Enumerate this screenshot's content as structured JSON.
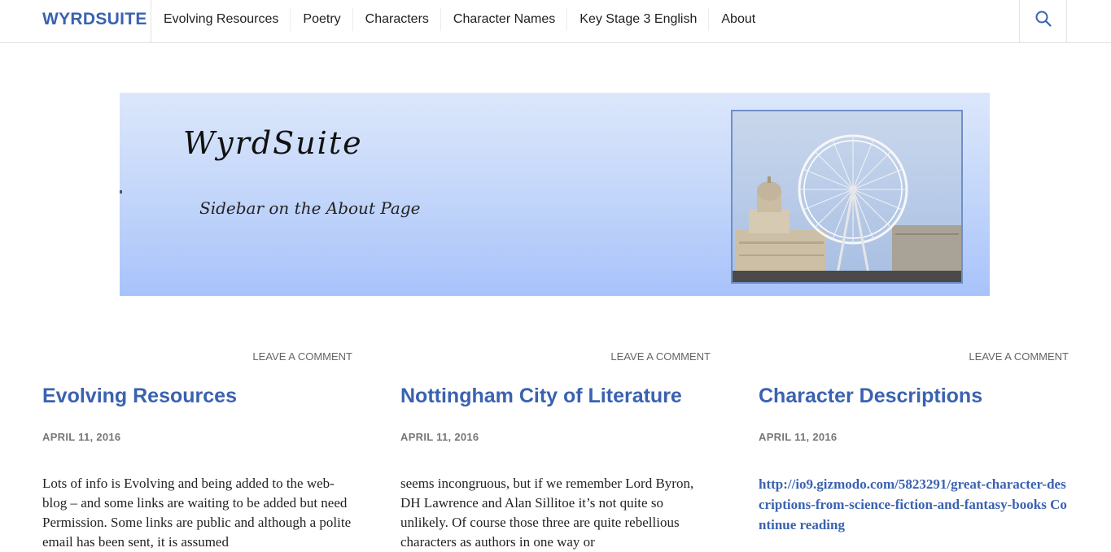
{
  "site": {
    "brand": "WYRDSUITE",
    "nav": [
      "Evolving Resources",
      "Poetry",
      "Characters",
      "Character Names",
      "Key Stage 3 English",
      "About"
    ],
    "search_icon": "search-icon"
  },
  "banner": {
    "title": "WyrdSuite",
    "subtitle": "Sidebar on the About Page",
    "photo": "ferris-wheel-city-hall-photo"
  },
  "posts": [
    {
      "meta": "LEAVE A COMMENT",
      "title": "Evolving Resources",
      "date": "APRIL 11, 2016",
      "excerpt": "Lots of info is Evolving and being added to the web-blog – and some links are waiting to be added but need Permission. Some links are public and although a polite email has been sent, it is assumed"
    },
    {
      "meta": "LEAVE A COMMENT",
      "title": "Nottingham City of Literature",
      "date": "APRIL 11, 2016",
      "excerpt": "seems incongruous, but if we remember Lord Byron, DH Lawrence and Alan Sillitoe it’s not quite so unlikely.  Of course those three are quite rebellious characters as authors in one way or"
    },
    {
      "meta": "LEAVE A COMMENT",
      "title": "Character Descriptions",
      "date": "APRIL 11, 2016",
      "link": "http://io9.gizmodo.com/5823291/great-character-descriptions-from-science-fiction-and-fantasy-books",
      "continue": "Continue reading"
    }
  ],
  "colors": {
    "accent": "#3a62b0",
    "banner_top": "#dce7fb",
    "banner_bottom": "#a8c3fb"
  }
}
